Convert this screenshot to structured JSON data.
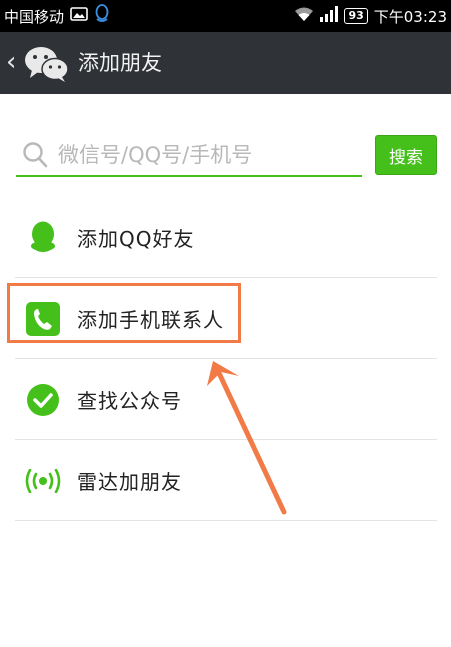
{
  "status_bar": {
    "carrier": "中国移动",
    "battery": "93",
    "time": "下午03:23"
  },
  "header": {
    "back_label": "‹",
    "title": "添加朋友"
  },
  "search": {
    "placeholder": "微信号/QQ号/手机号",
    "button_label": "搜索"
  },
  "menu": {
    "items": [
      {
        "label": "添加QQ好友",
        "icon": "qq-penguin-icon"
      },
      {
        "label": "添加手机联系人",
        "icon": "phone-icon"
      },
      {
        "label": "查找公众号",
        "icon": "checkmark-icon"
      },
      {
        "label": "雷达加朋友",
        "icon": "radar-icon"
      }
    ]
  },
  "colors": {
    "accent_green": "#45c01a",
    "header_bg": "#2f3236",
    "annotation": "#f27a46"
  }
}
